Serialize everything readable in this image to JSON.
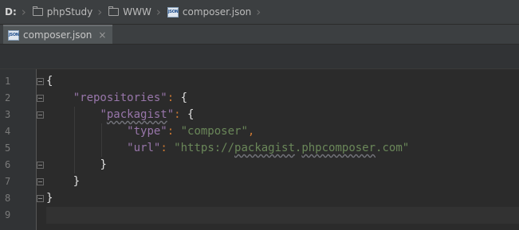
{
  "breadcrumb": {
    "drive": "D:",
    "folder1": "phpStudy",
    "folder2": "WWW",
    "file": "composer.json",
    "file_icon": "JSON"
  },
  "tab": {
    "label": "composer.json",
    "close": "×"
  },
  "gutter": {
    "line_numbers": [
      "1",
      "2",
      "3",
      "4",
      "5",
      "6",
      "7",
      "8",
      "9"
    ]
  },
  "code": {
    "brace_open": "{",
    "brace_close": "}",
    "key_repositories": "\"repositories\"",
    "key_packagist": "\"packagist\"",
    "key_type": "\"type\"",
    "key_url": "\"url\"",
    "colon": ": ",
    "comma": ",",
    "val_type": "\"composer\"",
    "val_url_prefix": "\"https://",
    "val_url_host1": "packagist",
    "val_url_dot": ".",
    "val_url_host2": "phpcomposer",
    "val_url_suffix": ".com\""
  },
  "colors": {
    "background": "#2b2b2b",
    "key": "#9876aa",
    "string": "#6a8759",
    "punctuation": "#cc7832"
  }
}
